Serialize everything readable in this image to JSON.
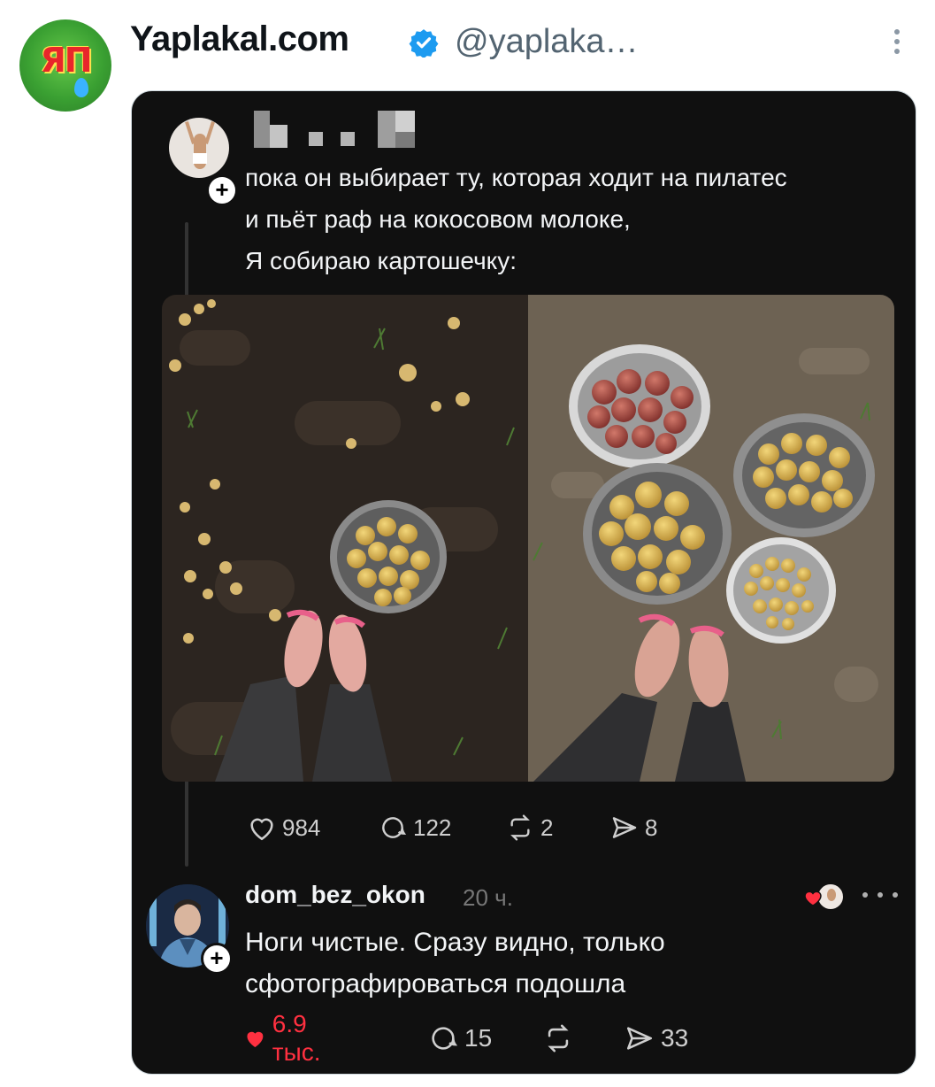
{
  "tweet": {
    "author_name": "Yaplakal.com",
    "handle": "@yaplaka…",
    "avatar_text": "ЯП"
  },
  "post": {
    "lines": [
      "пока он выбирает ту, которая ходит на пилатес",
      "и пьёт раф на кокосовом молоке,",
      "Я собираю картошечку:"
    ],
    "likes": "984",
    "comments": "122",
    "reposts": "2",
    "shares": "8"
  },
  "reply": {
    "username": "dom_bez_okon",
    "time": "20 ч.",
    "lines": [
      "Ноги чистые. Сразу видно, только",
      "сфотографироваться подошла"
    ],
    "likes": "6.9 тыс.",
    "comments": "15",
    "shares": "33"
  },
  "colors": {
    "card_bg": "#101010",
    "like_red": "#ff3040",
    "verified_blue": "#1d9bf0"
  }
}
